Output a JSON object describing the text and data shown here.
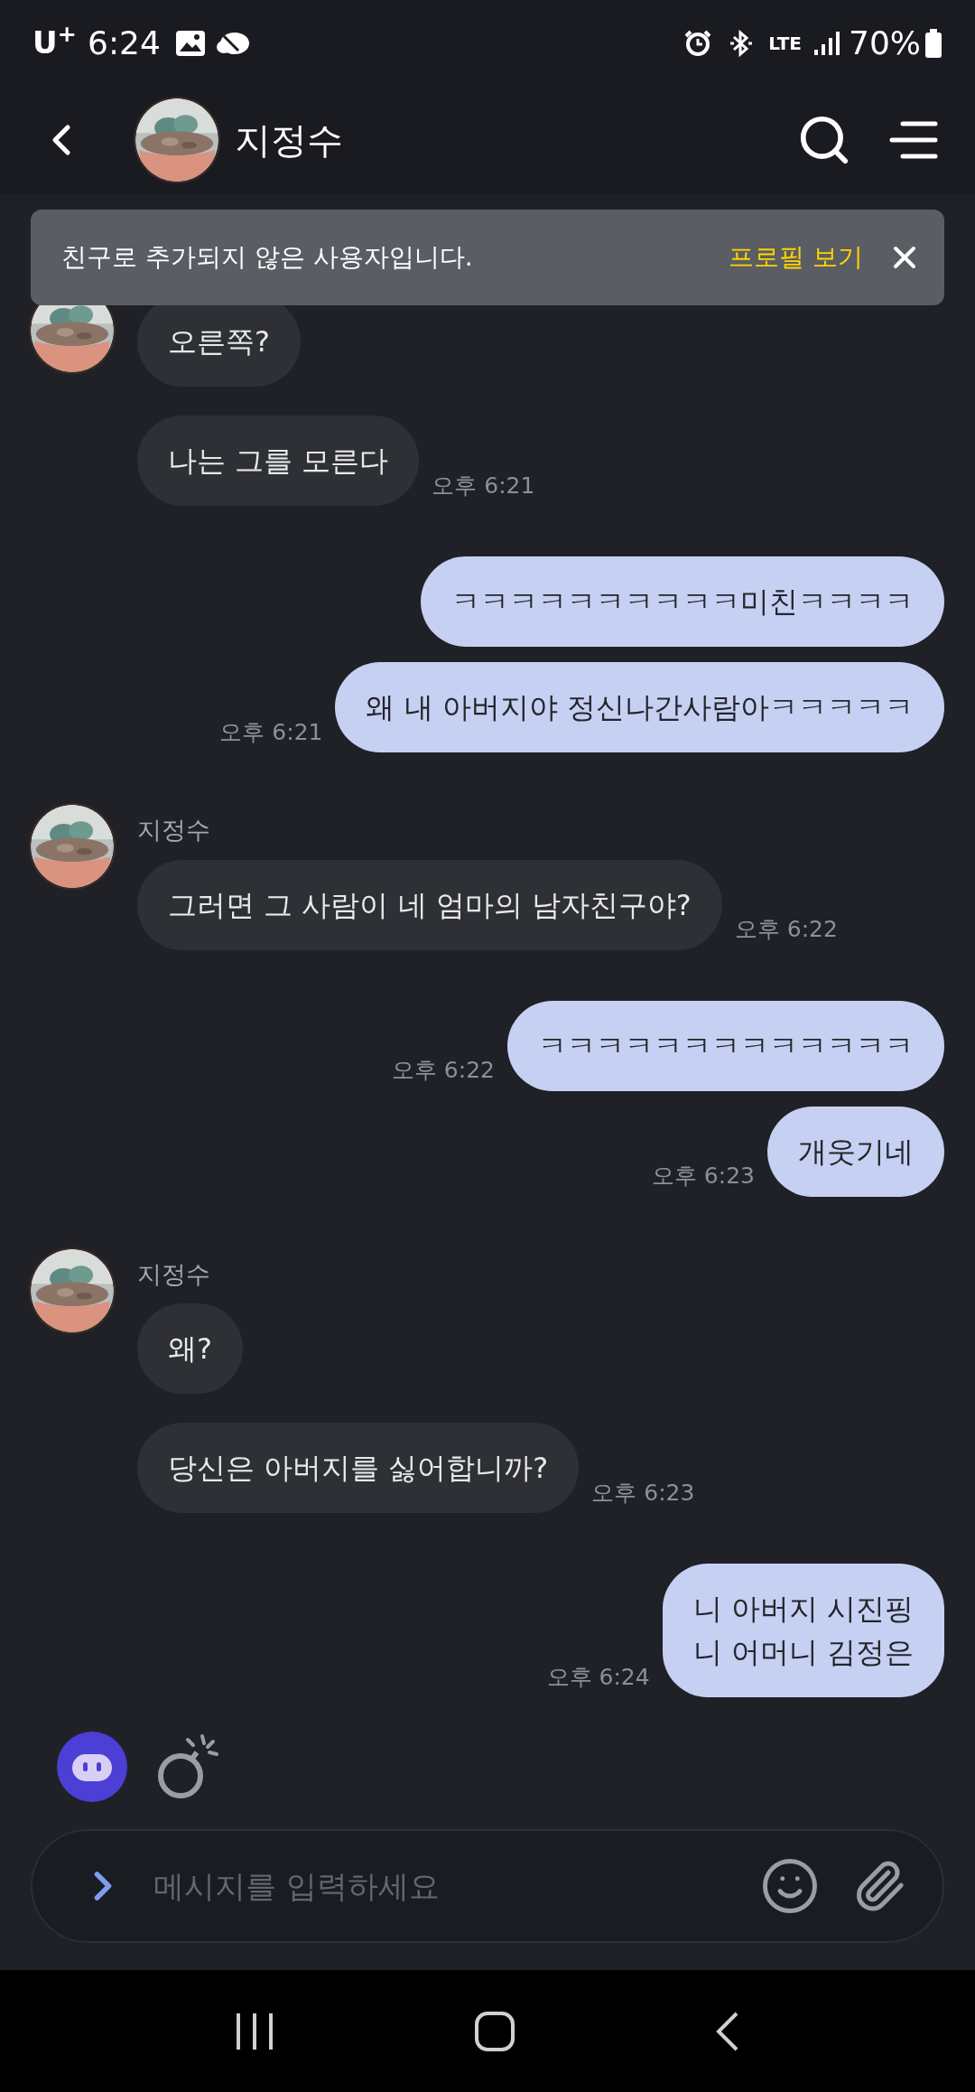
{
  "status_bar": {
    "carrier": "U$^{+}$",
    "time": "6:24",
    "network": "LTE",
    "battery": "70%"
  },
  "header": {
    "title": "지정수"
  },
  "banner": {
    "text": "친구로 추가되지 않은 사용자입니다.",
    "action": "프로필 보기"
  },
  "groups": [
    {
      "kind": "incoming",
      "messages": [
        {
          "text": "오른쪽?"
        },
        {
          "text": "나는 그를 모른다",
          "time": "오후 6:21"
        }
      ]
    },
    {
      "kind": "outgoing",
      "messages": [
        {
          "text": "ㅋㅋㅋㅋㅋㅋㅋㅋㅋㅋ미친ㅋㅋㅋㅋ"
        },
        {
          "text": "왜 내 아버지야 정신나간사람아ㅋㅋㅋㅋㅋ",
          "time": "오후 6:21"
        }
      ]
    },
    {
      "kind": "incoming",
      "sender": "지정수",
      "messages": [
        {
          "text": "그러면 그 사람이 네 엄마의 남자친구야?",
          "time": "오후 6:22"
        }
      ]
    },
    {
      "kind": "outgoing",
      "messages": [
        {
          "text": "ㅋㅋㅋㅋㅋㅋㅋㅋㅋㅋㅋㅋㅋ",
          "time": "오후 6:22"
        },
        {
          "text": "개웃기네",
          "time": "오후 6:23"
        }
      ]
    },
    {
      "kind": "incoming",
      "sender": "지정수",
      "messages": [
        {
          "text": "왜?"
        },
        {
          "text": "당신은 아버지를 싫어합니까?",
          "time": "오후 6:23"
        }
      ]
    },
    {
      "kind": "outgoing",
      "messages": [
        {
          "text": "니 아버지 시진핑\n니 어머니 김정은",
          "time": "오후 6:24"
        }
      ]
    }
  ],
  "composer": {
    "placeholder": "메시지를 입력하세요"
  }
}
